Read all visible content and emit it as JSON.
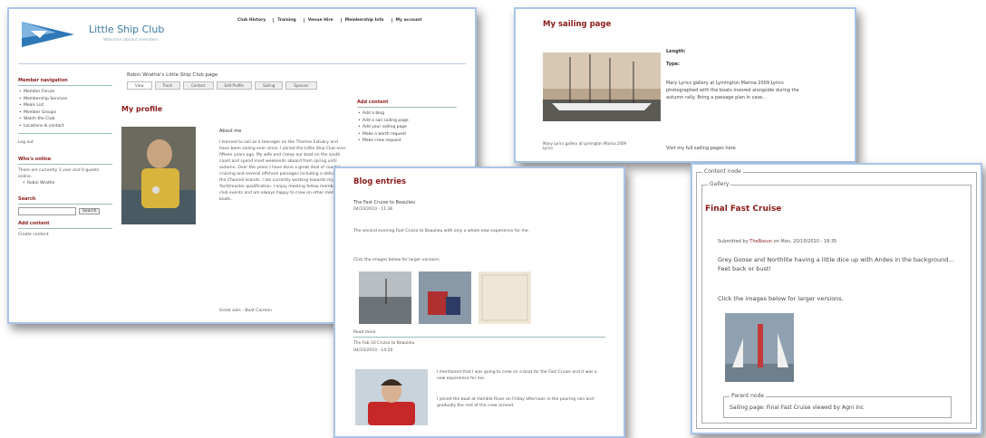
{
  "panel1": {
    "site_name": "Little Ship Club",
    "site_slogan": "Welcome aboard members",
    "top_nav": [
      "Club History",
      "Training",
      "Venue Hire",
      "Membership Info",
      "My account"
    ],
    "member_nav": {
      "title": "Member navigation",
      "items": [
        "Member Forum",
        "Membership Services",
        "Meals List",
        "Member Groups",
        "Watch the Club",
        "Locations & contact"
      ],
      "logout": "Log out"
    },
    "whos_online": {
      "title": "Who's online",
      "text": "There are currently 1 user and 0 guests online.",
      "user": "Robin Wrathe"
    },
    "search": {
      "title": "Search",
      "button": "Search"
    },
    "add_content_side": {
      "title": "Add content",
      "item": "Create content"
    },
    "page_title": "Robin Wrathe's Little Ship Club page",
    "tabs": [
      "View",
      "Track",
      "Contact",
      "Edit Profile",
      "Sailing",
      "Sponsor"
    ],
    "profile_title": "My profile",
    "about_title": "About me",
    "about_text": "I learned to sail as a teenager on the Thames Estuary and have been sailing ever since. I joined the Little Ship Club over fifteen years ago. My wife and I keep our boat on the south coast and spend most weekends aboard from spring until autumn. Over the years I have done a great deal of coastal cruising and several offshore passages including a delivery to the Channel Islands. I am currently working towards my Yachtmaster qualification. I enjoy meeting fellow members at club events and am always happy to crew on other members' boats.",
    "signoff": "Great sails - Boat Carmen",
    "add_content": {
      "title": "Add content",
      "items": [
        "Add a blog",
        "Add a sail sailing page",
        "Add your sailing page",
        "Make a berth request",
        "Make crew request"
      ]
    }
  },
  "panel2": {
    "title": "My sailing page",
    "length_label": "Length:",
    "type_label": "Type:",
    "caption": "Many Lyrics gallery at Lymington Marina 2009 Lyrics",
    "description": "Mary Lyrics gallery at Lymington Marina 2009 Lyrics photographed with the boats moored alongside during the autumn rally. Bring a passage plan in case...",
    "visit_text": "Visit my full sailing pages here"
  },
  "panel3": {
    "title": "Blog entries",
    "entry1": {
      "title": "The Fast Cruise to Beaulieu",
      "date": "04/10/2010 - 11:36",
      "text": "The second evening Fast Cruise to Beaulieu with only a whole new experience for me.",
      "click_text": "Click the images below for larger versions."
    },
    "read_more": "Read more",
    "entry2": {
      "title": "The Fab 10 Cruise to Beaulieu",
      "date": "04/10/2010 - 14:20",
      "text1": "I mentioned that I was going to crew on a boat for the Fast Cruise and it was a new experience for me.",
      "text2": "I joined the boat at Hamble River on Friday afternoon in the pouring rain and gradually the rest of the crew arrived."
    }
  },
  "panel4": {
    "legend_outer": "Content node",
    "legend_gallery": "Gallery",
    "title": "Final Fast Cruise",
    "submitted_prefix": "Submitted by",
    "author": "TheBosun",
    "submitted_suffix": "on Mon, 20/10/2010 - 18:35",
    "text": "Grey Goose and Northlite having a little dice up with Andes in the background... Feet back or bust!",
    "click_text": "Click the images below for larger versions.",
    "parent_legend": "Parent node",
    "parent_text": "Sailing page: Final Fast Cruise viewed by Agni Inc"
  },
  "colors": {
    "accent": "#8b1a1a",
    "border": "#a9c4e6",
    "site_name": "#3c7aa5"
  }
}
